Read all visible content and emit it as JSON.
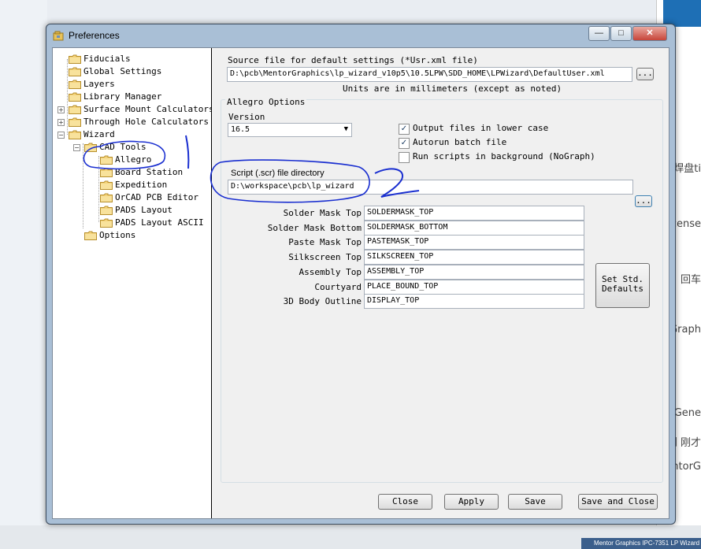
{
  "background": {
    "right_snippets": [
      "焊盘ti",
      "cense",
      "回车",
      "Graph",
      "Gene",
      "削 刚才",
      "entorG"
    ],
    "taskbar_item": "Mentor Graphics IPC-7351 LP Wizard"
  },
  "window": {
    "title": "Preferences",
    "controls": {
      "minimize": "—",
      "maximize": "□",
      "close": "✕"
    }
  },
  "tree": {
    "items": [
      {
        "label": "Fiducials"
      },
      {
        "label": "Global Settings"
      },
      {
        "label": "Layers"
      },
      {
        "label": "Library Manager"
      },
      {
        "label": "Surface Mount Calculators",
        "expander": "+"
      },
      {
        "label": "Through Hole Calculators",
        "expander": "+"
      },
      {
        "label": "Wizard",
        "expander": "−"
      },
      {
        "label": "CAD Tools",
        "expander": "−"
      },
      {
        "label": "Allegro"
      },
      {
        "label": "Board Station"
      },
      {
        "label": "Expedition"
      },
      {
        "label": "OrCAD PCB Editor"
      },
      {
        "label": "PADS Layout"
      },
      {
        "label": "PADS Layout ASCII"
      },
      {
        "label": "Options"
      }
    ]
  },
  "source": {
    "label": "Source file for default settings (*Usr.xml file)",
    "path": "D:\\pcb\\MentorGraphics\\lp_wizard_v10p5\\10.5LPW\\SDD_HOME\\LPWizard\\DefaultUser.xml",
    "browse": "...",
    "units_note": "Units are in millimeters (except as noted)"
  },
  "allegro": {
    "group_title": "Allegro Options",
    "version_label": "Version",
    "version_value": "16.5",
    "options": [
      {
        "label": "Output files in lower case",
        "checked": true
      },
      {
        "label": "Autorun batch file",
        "checked": true
      },
      {
        "label": "Run scripts in background (NoGraph)",
        "checked": false
      }
    ],
    "script_label": "Script (.scr) file directory",
    "script_value": "D:\\workspace\\pcb\\lp_wizard",
    "script_browse": "...",
    "layers": [
      {
        "label": "Solder Mask Top",
        "value": "SOLDERMASK_TOP"
      },
      {
        "label": "Solder Mask Bottom",
        "value": "SOLDERMASK_BOTTOM"
      },
      {
        "label": "Paste Mask Top",
        "value": "PASTEMASK_TOP"
      },
      {
        "label": "Silkscreen Top",
        "value": "SILKSCREEN_TOP"
      },
      {
        "label": "Assembly Top",
        "value": "ASSEMBLY_TOP"
      },
      {
        "label": "Courtyard",
        "value": "PLACE_BOUND_TOP"
      },
      {
        "label": "3D Body Outline",
        "value": "DISPLAY_TOP"
      }
    ],
    "set_defaults": [
      "Set Std.",
      "Defaults"
    ]
  },
  "footer": {
    "close": "Close",
    "apply": "Apply",
    "save": "Save",
    "save_and_close": "Save and Close"
  },
  "annotations": {
    "mark1": "1",
    "mark2": "2",
    "ink_color": "#1a2fd0"
  }
}
